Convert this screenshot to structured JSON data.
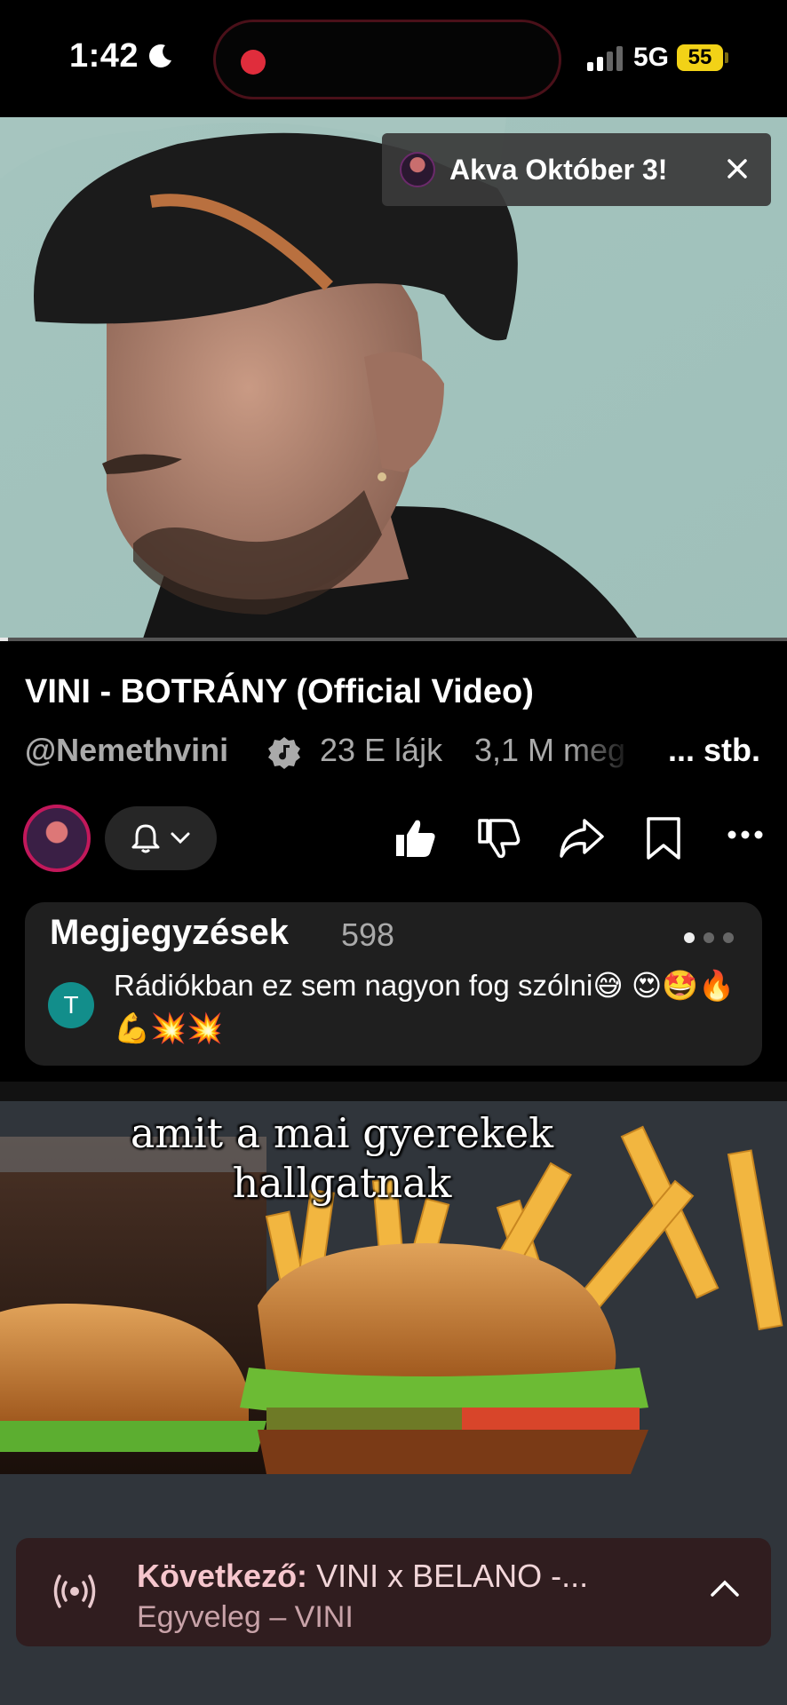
{
  "status_bar": {
    "time": "1:42",
    "network": "5G",
    "battery": "55",
    "colors": {
      "battery": "#f2d217",
      "recording": "#e02d3c"
    }
  },
  "video": {
    "chip_text": "Akva Október 3!",
    "progress": 0.01
  },
  "info": {
    "title": "VINI - BOTRÁNY (Official Video)",
    "channel_handle": "@Nemethvini",
    "likes": "23 E lájk",
    "views": "3,1 M meg",
    "more": "... stb."
  },
  "actions": {
    "icons": [
      "bell-icon",
      "chevron-down-icon",
      "like-icon",
      "dislike-icon",
      "share-icon",
      "save-icon",
      "more-icon"
    ]
  },
  "comments": {
    "title": "Megjegyzések",
    "count": "598",
    "author_initial": "T",
    "top_comment": "Rádiókban ez sem nagyon fog szólni😅 😍🤩🔥💪💥💥"
  },
  "short": {
    "caption": "amit a mai gyerekek hallgatnak"
  },
  "mini_player": {
    "label": "Következő:",
    "next_title": "VINI x BELANO -...",
    "subtitle": "Egyveleg – VINI"
  }
}
